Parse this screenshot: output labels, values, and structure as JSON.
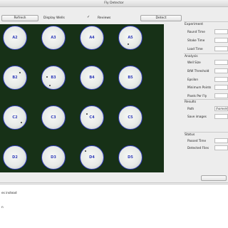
{
  "window": {
    "title": "Fly Detector"
  },
  "toolbar": {
    "refresh_label": "Refresh",
    "display_wells_label": "Display Wells",
    "display_wells_checked": false,
    "reviews_label": "Reviews",
    "reviews_checked": true,
    "detect_label": "Detect"
  },
  "wells": [
    {
      "label": "A2"
    },
    {
      "label": "A3"
    },
    {
      "label": "A4"
    },
    {
      "label": "A5"
    },
    {
      "label": "B2"
    },
    {
      "label": "B3"
    },
    {
      "label": "B4"
    },
    {
      "label": "B5"
    },
    {
      "label": "C2"
    },
    {
      "label": "C3"
    },
    {
      "label": "C4"
    },
    {
      "label": "C5"
    },
    {
      "label": "D2"
    },
    {
      "label": "D3"
    },
    {
      "label": "D4"
    },
    {
      "label": "D5"
    }
  ],
  "panel": {
    "experiment": {
      "title": "Experiment",
      "round_time": "Round Time",
      "shake_time": "Shake Time",
      "load_time": "Load Time"
    },
    "analysis": {
      "title": "Analysis",
      "well_size": "Well Size",
      "bw_threshold": "B/W Threshold",
      "epsilon": "Epsilon",
      "minimum_points": "Minimum Points",
      "pixels_per_fly": "Pixels Per Fly"
    },
    "results": {
      "title": "Results",
      "path_label": "Path",
      "path_value": "/home/m",
      "save_images": "Save images"
    },
    "status": {
      "title": "Status",
      "passed_time": "Passed Time",
      "detected_flies": "Detected Flies"
    }
  },
  "footer": {
    "button_label": ""
  },
  "log": {
    "line1": "es instead",
    "line2": "n"
  },
  "colors": {
    "plate_bg": "#173117",
    "well_outline": "#2f3bb8"
  }
}
